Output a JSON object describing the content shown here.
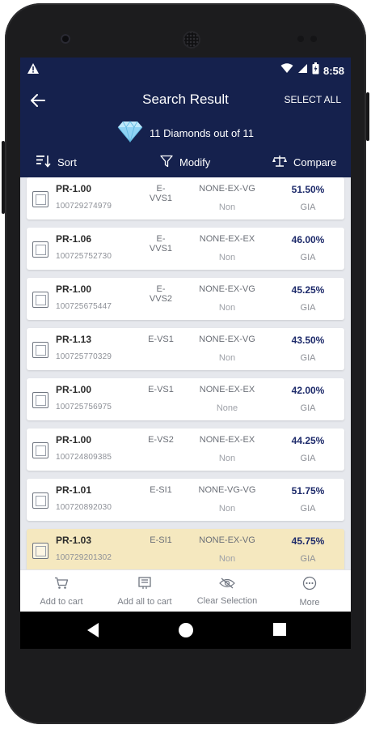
{
  "status_bar": {
    "time": "8:58",
    "icons": [
      "warning-icon",
      "wifi-icon",
      "signal-icon",
      "battery-icon"
    ]
  },
  "header": {
    "title": "Search Result",
    "select_all": "SELECT ALL",
    "count_text": "11 Diamonds out of 11",
    "bg_color": "#15214d"
  },
  "tools": {
    "sort": "Sort",
    "modify": "Modify",
    "compare": "Compare"
  },
  "results": [
    {
      "shape": "PR-1.00",
      "stock": "100729274979",
      "clarity": "E-VVS1",
      "cut": "NONE-EX-VG",
      "fluor": "Non",
      "discount": "51.50%",
      "lab": "GIA",
      "selected": false
    },
    {
      "shape": "PR-1.06",
      "stock": "100725752730",
      "clarity": "E-VVS1",
      "cut": "NONE-EX-EX",
      "fluor": "Non",
      "discount": "46.00%",
      "lab": "GIA",
      "selected": false
    },
    {
      "shape": "PR-1.00",
      "stock": "100725675447",
      "clarity": "E-VVS2",
      "cut": "NONE-EX-VG",
      "fluor": "Non",
      "discount": "45.25%",
      "lab": "GIA",
      "selected": false
    },
    {
      "shape": "PR-1.13",
      "stock": "100725770329",
      "clarity": "E-VS1",
      "cut": "NONE-EX-VG",
      "fluor": "Non",
      "discount": "43.50%",
      "lab": "GIA",
      "selected": false
    },
    {
      "shape": "PR-1.00",
      "stock": "100725756975",
      "clarity": "E-VS1",
      "cut": "NONE-EX-EX",
      "fluor": "None",
      "discount": "42.00%",
      "lab": "GIA",
      "selected": false
    },
    {
      "shape": "PR-1.00",
      "stock": "100724809385",
      "clarity": "E-VS2",
      "cut": "NONE-EX-EX",
      "fluor": "Non",
      "discount": "44.25%",
      "lab": "GIA",
      "selected": false
    },
    {
      "shape": "PR-1.01",
      "stock": "100720892030",
      "clarity": "E-SI1",
      "cut": "NONE-VG-VG",
      "fluor": "Non",
      "discount": "51.75%",
      "lab": "GIA",
      "selected": false
    },
    {
      "shape": "PR-1.03",
      "stock": "100729201302",
      "clarity": "E-SI1",
      "cut": "NONE-EX-VG",
      "fluor": "Non",
      "discount": "45.75%",
      "lab": "GIA",
      "selected": true
    }
  ],
  "actions": {
    "add_to_cart": "Add to cart",
    "add_all_to_cart": "Add all to cart",
    "clear_selection": "Clear Selection",
    "more": "More"
  },
  "colors": {
    "accent": "#15214d",
    "discount_text": "#1d2a6a",
    "selected_row": "#f5e8bf"
  }
}
